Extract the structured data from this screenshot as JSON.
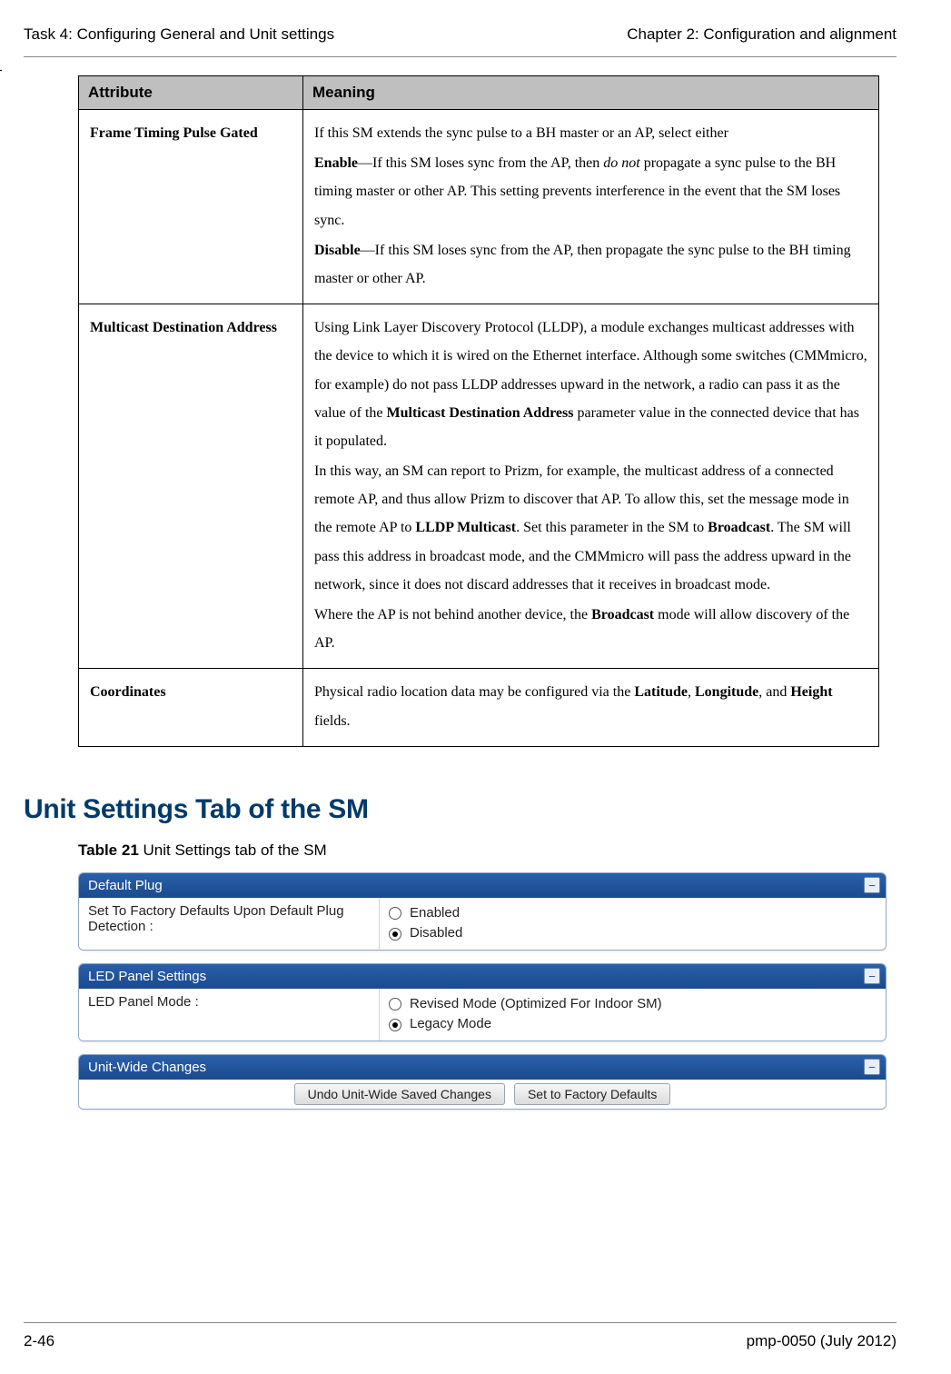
{
  "header": {
    "left": "Task 4: Configuring General and Unit settings",
    "right": "Chapter 2:  Configuration and alignment"
  },
  "dash": "-",
  "table": {
    "head": {
      "attr": "Attribute",
      "meaning": "Meaning"
    },
    "rows": [
      {
        "attr": "Frame Timing Pulse Gated",
        "meaning_parts": {
          "p1": "If this SM extends the sync pulse to a BH master or an AP, select either",
          "p2a": "Enable",
          "p2b": "—If this SM loses sync from the AP, then ",
          "p2c": "do not",
          "p2d": " propagate a sync pulse to the BH timing master or other AP. This setting prevents interference in the event that the SM loses sync.",
          "p3a": "Disable",
          "p3b": "—If this SM loses sync from the AP, then propagate the sync pulse to the BH timing master or other AP."
        }
      },
      {
        "attr": "Multicast Destination Address",
        "meaning_parts": {
          "p1a": "Using Link Layer Discovery Protocol (LLDP), a module exchanges multicast addresses with the device to which it is wired on the Ethernet interface. Although some switches (CMMmicro, for example) do not pass LLDP addresses upward in the network, a radio can pass it as the value of the ",
          "p1b": "Multicast Destination Address",
          "p1c": " parameter value in the connected device that has it populated.",
          "p2a": "In this way, an SM can report to Prizm, for example, the multicast address of a connected remote AP, and thus allow Prizm to discover that AP. To allow this, set the message mode in the remote AP to ",
          "p2b": "LLDP Multicast",
          "p2c": ". Set this parameter in the SM to ",
          "p2d": "Broadcast",
          "p2e": ". The SM will pass this address in broadcast mode, and the CMMmicro will pass the address upward in the network, since it does not discard addresses that it receives in broadcast mode.",
          "p3a": "Where the AP is not behind another device, the ",
          "p3b": "Broadcast",
          "p3c": " mode will allow discovery of the AP."
        }
      },
      {
        "attr": "Coordinates",
        "meaning_parts": {
          "p1a": "Physical radio location data may be configured via the ",
          "p1b": "Latitude",
          "p1c": ", ",
          "p1d": "Longitude",
          "p1e": ", and ",
          "p1f": "Height",
          "p1g": " fields."
        }
      }
    ]
  },
  "section_heading": "Unit Settings Tab of the SM",
  "caption": {
    "label": "Table 21",
    "text": "  Unit Settings tab of the SM"
  },
  "panels": {
    "default_plug": {
      "title": "Default Plug",
      "label": "Set To Factory Defaults Upon Default Plug Detection :",
      "opt_enabled": "Enabled",
      "opt_disabled": "Disabled"
    },
    "led": {
      "title": "LED Panel Settings",
      "label": "LED Panel Mode :",
      "opt_revised": "Revised Mode (Optimized For Indoor SM)",
      "opt_legacy": "Legacy Mode"
    },
    "unit_wide": {
      "title": "Unit-Wide Changes",
      "btn_undo": "Undo Unit-Wide Saved Changes",
      "btn_defaults": "Set to Factory Defaults"
    }
  },
  "footer": {
    "left": "2-46",
    "right": "pmp-0050 (July 2012)"
  }
}
